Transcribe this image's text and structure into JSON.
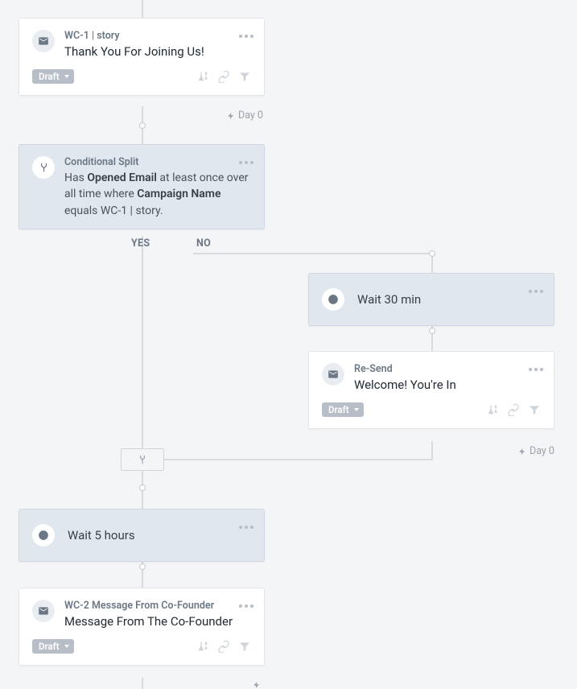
{
  "labels": {
    "draft": "Draft",
    "day0": "Day 0",
    "yes": "YES",
    "no": "NO"
  },
  "cards": {
    "email1": {
      "eyebrow": "WC-1 | story",
      "title": "Thank You For Joining Us!"
    },
    "split": {
      "eyebrow": "Conditional Split",
      "pre": "Has ",
      "metric": "Opened Email",
      "mid": " at least once over all time where ",
      "field": "Campaign Name",
      "post": " equals WC-1 | story."
    },
    "wait30": {
      "title": "Wait 30 min"
    },
    "resend": {
      "eyebrow": "Re-Send",
      "title": "Welcome! You're In"
    },
    "wait5h": {
      "title": "Wait 5 hours"
    },
    "email2": {
      "eyebrow": "WC-2 Message From Co-Founder",
      "title": "Message From The Co-Founder"
    }
  }
}
